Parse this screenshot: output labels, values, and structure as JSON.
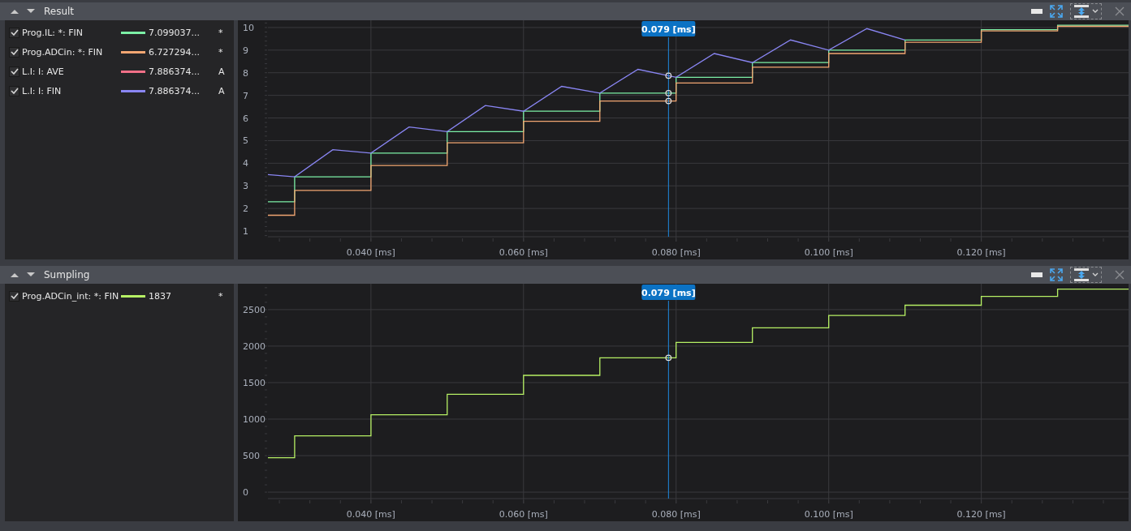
{
  "panels": [
    {
      "title": "Result",
      "legend": [
        {
          "checked": true,
          "name": "Prog.IL: *: FIN",
          "color": "#7cf0a6",
          "value": "7.099037...",
          "flag": "*"
        },
        {
          "checked": true,
          "name": "Prog.ADCin: *: FIN",
          "color": "#f2a672",
          "value": "6.727294...",
          "flag": "*"
        },
        {
          "checked": true,
          "name": "L.I: I: AVE",
          "color": "#f27088",
          "value": "7.886374...",
          "flag": "A"
        },
        {
          "checked": true,
          "name": "L.I: I: FIN",
          "color": "#8a86f4",
          "value": "7.886374...",
          "flag": "A"
        }
      ],
      "chart_data": {
        "type": "line",
        "grid": true,
        "x": [
          0.0265,
          0.03,
          0.03,
          0.035,
          0.04,
          0.04,
          0.045,
          0.05,
          0.05,
          0.055,
          0.06,
          0.06,
          0.065,
          0.07,
          0.07,
          0.075,
          0.08,
          0.08,
          0.085,
          0.09,
          0.09,
          0.095,
          0.1,
          0.1,
          0.105,
          0.11,
          0.11,
          0.115,
          0.12,
          0.12,
          0.125,
          0.13,
          0.13,
          0.1393
        ],
        "xlim": [
          0.0265,
          0.1393
        ],
        "ylim": [
          0.75,
          10.32
        ],
        "xticks": [
          {
            "value": 0.04,
            "label": "0.040 [ms]"
          },
          {
            "value": 0.06,
            "label": "0.060 [ms]"
          },
          {
            "value": 0.08,
            "label": "0.080 [ms]"
          },
          {
            "value": 0.1,
            "label": "0.100 [ms]"
          },
          {
            "value": 0.12,
            "label": "0.120 [ms]"
          }
        ],
        "yticks": [
          1,
          2,
          3,
          4,
          5,
          6,
          7,
          8,
          9,
          10
        ],
        "series": [
          {
            "color": "#7cf0a6",
            "values": [
              2.3,
              2.3,
              3.4,
              3.4,
              3.4,
              4.45,
              4.45,
              4.45,
              5.4,
              5.4,
              5.4,
              6.3,
              6.3,
              6.3,
              7.1,
              7.1,
              7.1,
              7.8,
              7.8,
              7.8,
              8.45,
              8.45,
              8.45,
              9.0,
              9.0,
              9.0,
              9.45,
              9.45,
              9.45,
              9.9,
              9.9,
              9.9,
              10.1,
              10.1
            ]
          },
          {
            "color": "#f2a672",
            "values": [
              1.7,
              1.7,
              2.8,
              2.8,
              2.8,
              3.9,
              3.9,
              3.9,
              4.9,
              4.9,
              4.9,
              5.85,
              5.85,
              5.85,
              6.75,
              6.75,
              6.75,
              7.55,
              7.55,
              7.55,
              8.25,
              8.25,
              8.25,
              8.85,
              8.85,
              8.85,
              9.35,
              9.35,
              9.35,
              9.85,
              9.85,
              9.85,
              10.05,
              10.05
            ]
          },
          {
            "color": "#8a86f4",
            "values": [
              3.5,
              3.4,
              3.4,
              4.6,
              4.45,
              4.45,
              5.6,
              5.4,
              5.4,
              6.55,
              6.3,
              6.3,
              7.4,
              7.1,
              7.1,
              8.15,
              7.8,
              7.8,
              8.85,
              8.45,
              8.45,
              9.45,
              9.0,
              9.0,
              9.95,
              9.45,
              9.45,
              null,
              null,
              null,
              null,
              null,
              null,
              null
            ]
          }
        ],
        "ref_lines": [
          {
            "axis": "x",
            "value": 0.079,
            "label": "0.079 [ms]"
          }
        ]
      }
    },
    {
      "title": "Sumpling",
      "legend": [
        {
          "checked": true,
          "name": "Prog.ADCin_int: *: FIN",
          "color": "#b6f064",
          "value": "1837",
          "flag": "*"
        }
      ],
      "chart_data": {
        "type": "line",
        "grid": true,
        "x": [
          0.0265,
          0.03,
          0.03,
          0.035,
          0.04,
          0.04,
          0.045,
          0.05,
          0.05,
          0.055,
          0.06,
          0.06,
          0.065,
          0.07,
          0.07,
          0.075,
          0.08,
          0.08,
          0.085,
          0.09,
          0.09,
          0.095,
          0.1,
          0.1,
          0.105,
          0.11,
          0.11,
          0.115,
          0.12,
          0.12,
          0.125,
          0.13,
          0.13,
          0.1393
        ],
        "xlim": [
          0.0265,
          0.1393
        ],
        "ylim": [
          -88,
          2854
        ],
        "xticks": [
          {
            "value": 0.04,
            "label": "0.040 [ms]"
          },
          {
            "value": 0.06,
            "label": "0.060 [ms]"
          },
          {
            "value": 0.08,
            "label": "0.080 [ms]"
          },
          {
            "value": 0.1,
            "label": "0.100 [ms]"
          },
          {
            "value": 0.12,
            "label": "0.120 [ms]"
          }
        ],
        "yticks": [
          0,
          500,
          1000,
          1500,
          2000,
          2500
        ],
        "series": [
          {
            "color": "#b6f064",
            "values": [
              470,
              470,
              770,
              770,
              770,
              1060,
              1060,
              1060,
              1340,
              1340,
              1340,
              1600,
              1600,
              1600,
              1840,
              1840,
              1840,
              2050,
              2050,
              2050,
              2250,
              2250,
              2250,
              2420,
              2420,
              2420,
              2560,
              2560,
              2560,
              2680,
              2680,
              2680,
              2780,
              2780
            ]
          }
        ],
        "ref_lines": [
          {
            "axis": "x",
            "value": 0.079,
            "label": "0.079 [ms]"
          }
        ]
      }
    }
  ]
}
